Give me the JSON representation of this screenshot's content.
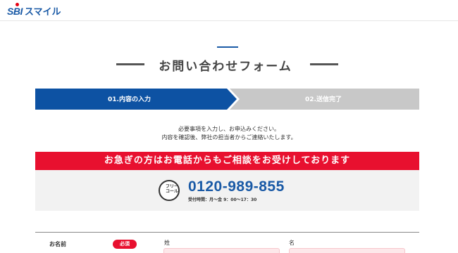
{
  "header": {
    "logo_sbi": "SBI",
    "logo_text": "スマイル"
  },
  "page": {
    "title": "お問い合わせフォーム"
  },
  "steps": [
    {
      "label": "01.内容の入力",
      "active": true,
      "color": "#0d52a3"
    },
    {
      "label": "02.送信完了",
      "active": false,
      "color": "#c8c8c8"
    }
  ],
  "intro": {
    "line1": "必要事項を入力し、お申込みください。",
    "line2": "内容を確認後、弊社の担当者からご連絡いたします。"
  },
  "urgent": {
    "text": "お急ぎの方はお電話からもご相談をお受けしております",
    "color": "#e8102f"
  },
  "contact": {
    "icon_text": "フリーコール",
    "phone": "0120-989-855",
    "hours": "受付時間：月〜金 9：00〜17：30"
  },
  "form": {
    "name_label": "お名前",
    "required_badge": "必須",
    "last_name_label": "姓",
    "first_name_label": "名",
    "last_name_value": "",
    "first_name_value": ""
  }
}
